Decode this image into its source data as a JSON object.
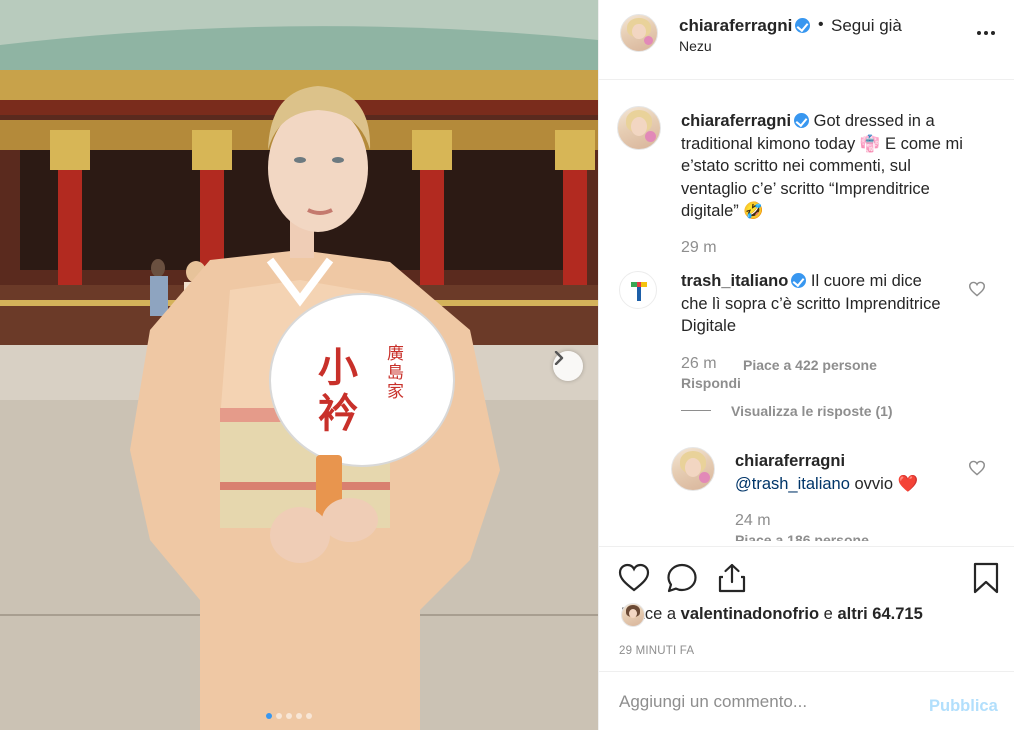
{
  "photo": {
    "fan_text_main": "小衿",
    "fan_text_side": "廣島家",
    "carousel_count": 5,
    "carousel_active": 1
  },
  "header": {
    "username": "chiaraferragni",
    "bullet": "•",
    "follow_status": "Segui già",
    "location": "Nezu"
  },
  "caption": {
    "username": "chiaraferragni",
    "text": "Got dressed in a traditional kimono today 👘 E come mi e’stato scritto nei commenti, sul ventaglio c’e’ scritto “Imprenditrice digitale” 🤣",
    "time": "29 m"
  },
  "comments": [
    {
      "username": "trash_italiano",
      "text": "Il cuore mi dice che lì sopra c’è scritto Imprenditrice Digitale",
      "time": "26 m",
      "likes": "Piace a 422 persone",
      "reply": "Rispondi",
      "view_replies": "Visualizza le risposte (1)",
      "replies": [
        {
          "username": "chiaraferragni",
          "mention": "@trash_italiano",
          "text": "ovvio ❤️",
          "time": "24 m",
          "likes": "Piace a 186 persone"
        }
      ]
    }
  ],
  "actions": {
    "likes_prefix": "Piace a",
    "likes_user": "valentinadonofrio",
    "likes_mid": "e",
    "likes_others": "altri 64.715",
    "timestamp": "29 MINUTI FA"
  },
  "add_comment": {
    "placeholder": "Aggiungi un commento...",
    "publish": "Pubblica"
  },
  "colors": {
    "accent": "#3897f0",
    "meta": "#8e8e8e",
    "publish_disabled": "#b2dffc",
    "text": "#262626"
  }
}
